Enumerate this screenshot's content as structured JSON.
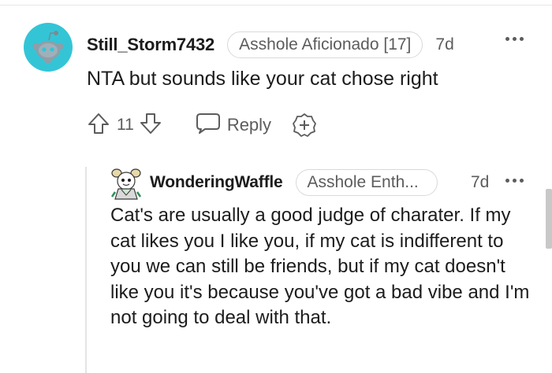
{
  "comment": {
    "username": "Still_Storm7432",
    "flair": "Asshole Aficionado [17]",
    "timestamp": "7d",
    "body": "NTA but sounds like your cat chose right",
    "vote_count": "11",
    "reply_label": "Reply",
    "avatar_color": "#33c5d6"
  },
  "reply": {
    "username": "WonderingWaffle",
    "flair": "Asshole Enth...",
    "timestamp": "7d",
    "body": "Cat's are usually a good judge of charater. If my cat likes you I like you, if my cat is indifferent to you we can still be friends, but if my cat doesn't like you it's because you've got a bad vibe and I'm not going to deal with that."
  },
  "colors": {
    "text": "#1c1c1c",
    "meta": "#5c5c5c",
    "border": "#d9d9d9"
  }
}
